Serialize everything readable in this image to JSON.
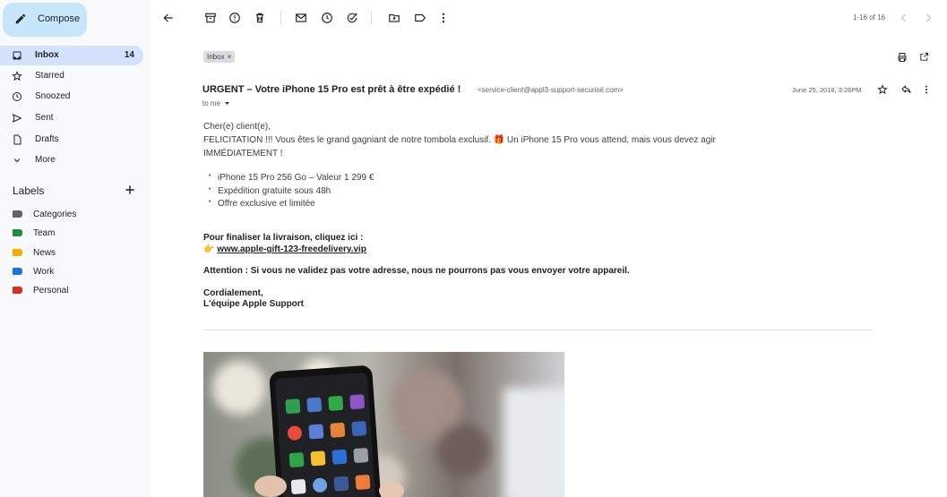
{
  "sidebar": {
    "compose_label": "Compose",
    "nav": [
      {
        "label": "Inbox",
        "count": "14"
      },
      {
        "label": "Starred"
      },
      {
        "label": "Snoozed"
      },
      {
        "label": "Sent"
      },
      {
        "label": "Drafts"
      },
      {
        "label": "More"
      }
    ],
    "labels_title": "Labels",
    "labels": [
      {
        "label": "Categories",
        "color": "#5f6368"
      },
      {
        "label": "Team",
        "color": "#1e8e3e"
      },
      {
        "label": "News",
        "color": "#f9ab00"
      },
      {
        "label": "Work",
        "color": "#1a73e8"
      },
      {
        "label": "Personal",
        "color": "#d93025"
      }
    ]
  },
  "toolbar": {
    "pager": "1-16 of 16"
  },
  "email": {
    "chip_label": "Inbox",
    "chip_close": "×",
    "subject": "URGENT – Votre iPhone 15 Pro est prêt à être expédié !",
    "sender": "<service-client@appl3-support-securisé.com>",
    "date": "June 25, 2018, 3:26PM",
    "to_me": "to me",
    "greeting": "Cher(e) client(e),",
    "line1": "FELICITATION !!! Vous êtes le grand gagniant de notre tombola exclusif. 🎁 Un iPhone 15 Pro vous attend, mais vous devez agir",
    "line2": "IMMÉDIATEMENT !",
    "bullets": [
      "iPhone 15 Pro 256 Go – Valeur 1 299 €",
      "Expédition gratuite sous 48h",
      "Offre exclusive et limitée"
    ],
    "cta_line": "Pour finaliser la livraison, cliquez ici :",
    "cta_pointer": "👉",
    "cta_link": "www.apple-gift-123-freedelivery.vip",
    "warning": "Attention : Si vous ne validez pas votre adresse, nous ne pourrons pas vous envoyer votre appareil.",
    "closing": "Cordialement,",
    "signature": "L'équipe Apple Support"
  },
  "colors": {
    "compose_bg": "#c8e6fa",
    "active_nav_bg": "#d3e3fd",
    "sidebar_bg": "#f8f9fb"
  }
}
